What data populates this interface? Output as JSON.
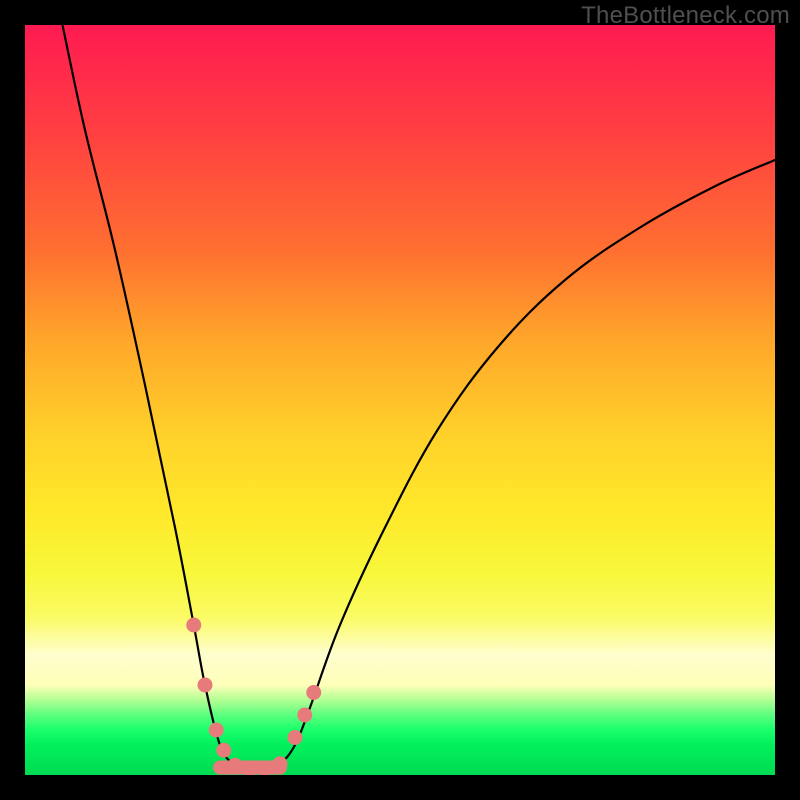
{
  "watermark": "TheBottleneck.com",
  "colors": {
    "frame": "#000000",
    "curve": "#000000",
    "marker": "#e77b7b",
    "gradient_top": "#ff1a52",
    "gradient_bottom": "#00db53"
  },
  "chart_data": {
    "type": "line",
    "title": "",
    "xlabel": "",
    "ylabel": "",
    "xlim": [
      0,
      100
    ],
    "ylim": [
      0,
      100
    ],
    "notes": "V-shaped bottleneck curve over a vertical rainbow gradient. Curve starts at top-left, drops to a flat minimum near x≈26–34%, then rises with diminishing slope toward the upper-right. Salmon-colored markers cluster around the minimum on both sides; a thick salmon segment marks the flat bottom.",
    "series": [
      {
        "name": "bottleneck-curve",
        "x": [
          5,
          8,
          12,
          16,
          20,
          22.5,
          24,
          26,
          28,
          30,
          32,
          34,
          36,
          38,
          42,
          48,
          55,
          63,
          72,
          82,
          92,
          100
        ],
        "values": [
          100,
          86,
          70,
          52,
          33,
          20,
          12,
          4,
          1.3,
          0.8,
          0.8,
          1.5,
          4,
          9,
          20,
          33,
          46,
          57,
          66,
          73,
          78.5,
          82
        ]
      }
    ],
    "floor_segment": {
      "x": [
        26,
        34
      ],
      "y": 1
    },
    "markers": [
      {
        "x": 22.5,
        "y": 20
      },
      {
        "x": 24,
        "y": 12
      },
      {
        "x": 25.5,
        "y": 6
      },
      {
        "x": 26.5,
        "y": 3.3
      },
      {
        "x": 28,
        "y": 1.3
      },
      {
        "x": 30,
        "y": 0.8
      },
      {
        "x": 32,
        "y": 0.8
      },
      {
        "x": 34,
        "y": 1.5
      },
      {
        "x": 36.0,
        "y": 5
      },
      {
        "x": 37.3,
        "y": 8
      },
      {
        "x": 38.5,
        "y": 11
      }
    ]
  }
}
